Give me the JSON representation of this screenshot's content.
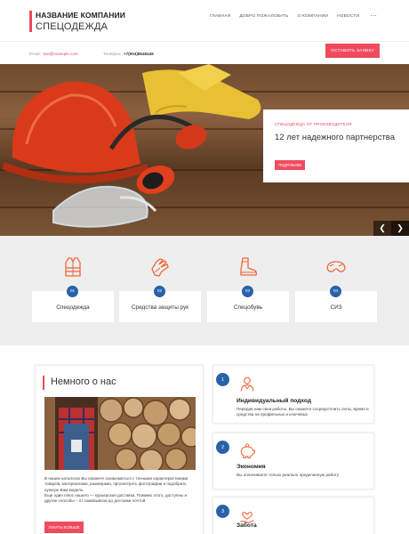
{
  "brand": {
    "title": "НАЗВАНИЕ КОМПАНИИ",
    "subtitle": "СПЕЦОДЕЖДА"
  },
  "nav": {
    "items": [
      "ГЛАВНАЯ",
      "ДОБРО ПОЖАЛОВАТЬ",
      "О КОМПАНИИ",
      "НОВОСТИ"
    ],
    "more": "⋯"
  },
  "contacts": {
    "email_label": "Email:",
    "email": "test@example.com",
    "phone_label": "Телефон:",
    "phone": "+7(904)8548446"
  },
  "cta": {
    "label": "ОСТАВИТЬ ЗАЯВКУ"
  },
  "slider": {
    "kicker": "СПЕЦОДЕЖДА ОТ ПРОИЗВОДИТЕЛЯ",
    "title": "12 лет надежного партнерства",
    "button": "ПОДРОБНЕЕ",
    "prev": "❮",
    "next": "❯"
  },
  "categories": [
    {
      "num": "01",
      "label": "Спецодежда",
      "icon": "vest-icon"
    },
    {
      "num": "02",
      "label": "Средства защиты рук",
      "icon": "gloves-icon"
    },
    {
      "num": "03",
      "label": "Спецобувь",
      "icon": "boot-icon"
    },
    {
      "num": "04",
      "label": "СИЗ",
      "icon": "goggles-icon"
    }
  ],
  "about": {
    "title": "Немного о нас",
    "text_1": "В наших каталогах Вы сможете ознакомиться с точными характеристиками товаров, материалами, размерами, просмотреть фотографии и подобрать нужную Вам модель.",
    "text_2": "Еще один плюс нашего — курьерская доставка. Помимо этого, доступны и другие способы – от самовывоза до доставки почтой.",
    "button": "УЗНАТЬ БОЛЬШЕ"
  },
  "features": [
    {
      "num": "1",
      "title": "Индивидуальный подход",
      "desc": "Передав нам свои работы, Вы сможете сосредоточить силы, время и средства на профильных и ключевых",
      "icon": "person-icon"
    },
    {
      "num": "2",
      "title": "Экономия",
      "desc": "Вы оплачиваете только реально проделанную работу",
      "icon": "piggy-bank-icon"
    },
    {
      "num": "3",
      "title": "Забота",
      "desc": "",
      "icon": "care-icon"
    }
  ],
  "colors": {
    "accent": "#f04b5d",
    "blue": "#2862a8",
    "icon_orange": "#f2673a"
  }
}
